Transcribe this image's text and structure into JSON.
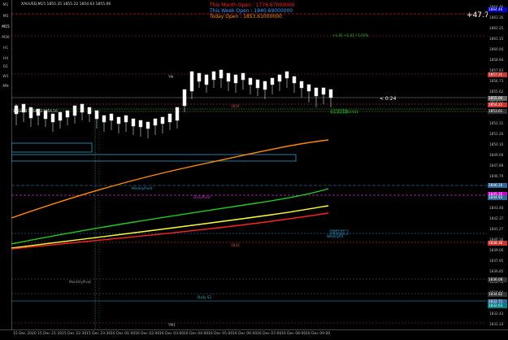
{
  "symbol_header": "XAUUSD,M15 1855.35 1855.22 1854.63 1855.06",
  "timeframes": [
    "M1",
    "M5",
    "M15",
    "M30",
    "H1",
    "H4",
    "D1",
    "W1",
    "MN"
  ],
  "active_timeframe": "M15",
  "info": {
    "month_open": "This Month Open : 1776.67000000",
    "week_open": "This Week Open : 1840.69000000",
    "today_open": "Today Open : 1853.61000000"
  },
  "big_value": "+47.7",
  "candle_timer": "< 0:24",
  "price_scale": [
    "1864.46",
    "1863.35",
    "1862.25",
    "1861.15",
    "1860.04",
    "1858.94",
    "1857.83",
    "1856.73",
    "1855.62",
    "1854.52",
    "1853.41",
    "1852.31",
    "1851.20",
    "1850.10",
    "1849.00",
    "1847.89",
    "1846.79",
    "1845.68",
    "1844.58",
    "1843.48",
    "1842.37",
    "1841.27",
    "1840.16",
    "1839.06",
    "1837.95",
    "1836.85",
    "1835.74",
    "1834.64",
    "1833.54",
    "1832.43",
    "1831.33"
  ],
  "price_tags": [
    {
      "text": "1864.46",
      "color": "#0000cc"
    },
    {
      "text": "1857.31",
      "color": "#cc3333"
    },
    {
      "text": "1855.06",
      "color": "#666666"
    },
    {
      "text": "1854.21",
      "color": "#cc3333"
    },
    {
      "text": "1853.61",
      "color": "#333333"
    },
    {
      "text": "1846.16",
      "color": "#336699"
    },
    {
      "text": "1845.35",
      "color": "#cc00cc"
    },
    {
      "text": "1844.93",
      "color": "#336699"
    },
    {
      "text": "1838.36",
      "color": "#cc3333"
    },
    {
      "text": "1836.08",
      "color": "#333333"
    },
    {
      "text": "1834.82",
      "color": "#333333"
    },
    {
      "text": "1832.71",
      "color": "#336699"
    },
    {
      "text": "1832.63",
      "color": "#008080"
    }
  ],
  "time_labels": [
    "15 Dec 2020",
    "15 Dec 21:30",
    "15 Dec 22:30",
    "15 Dec 23:30",
    "16 Dec 01:00",
    "16 Dec 02:00",
    "16 Dec 03:00",
    "16 Dec 04:00",
    "16 Dec 05:00",
    "16 Dec 06:00",
    "16 Dec 07:00",
    "16 Dec 08:00",
    "16 Dec 09:00"
  ],
  "labels": {
    "ema_tag": "+1.01/1853.611",
    "vwap_top": "+1.01 +1.01 / 1.01%",
    "line_label_a": "YM",
    "line_label_b": "1844",
    "weekly_pivot": "WeeklyPivot",
    "daily_pivot": "DailyPivot",
    "monthly_pivot": "MonthlyPivot",
    "daily_s1": "Daily S1",
    "level_1843": "1843",
    "weekly_r1": "WeeklyR1",
    "level_ym2": "YM1",
    "cme_label": "1853.61",
    "box_left_lbl": "1853.94 1854.53 1854.10"
  }
}
